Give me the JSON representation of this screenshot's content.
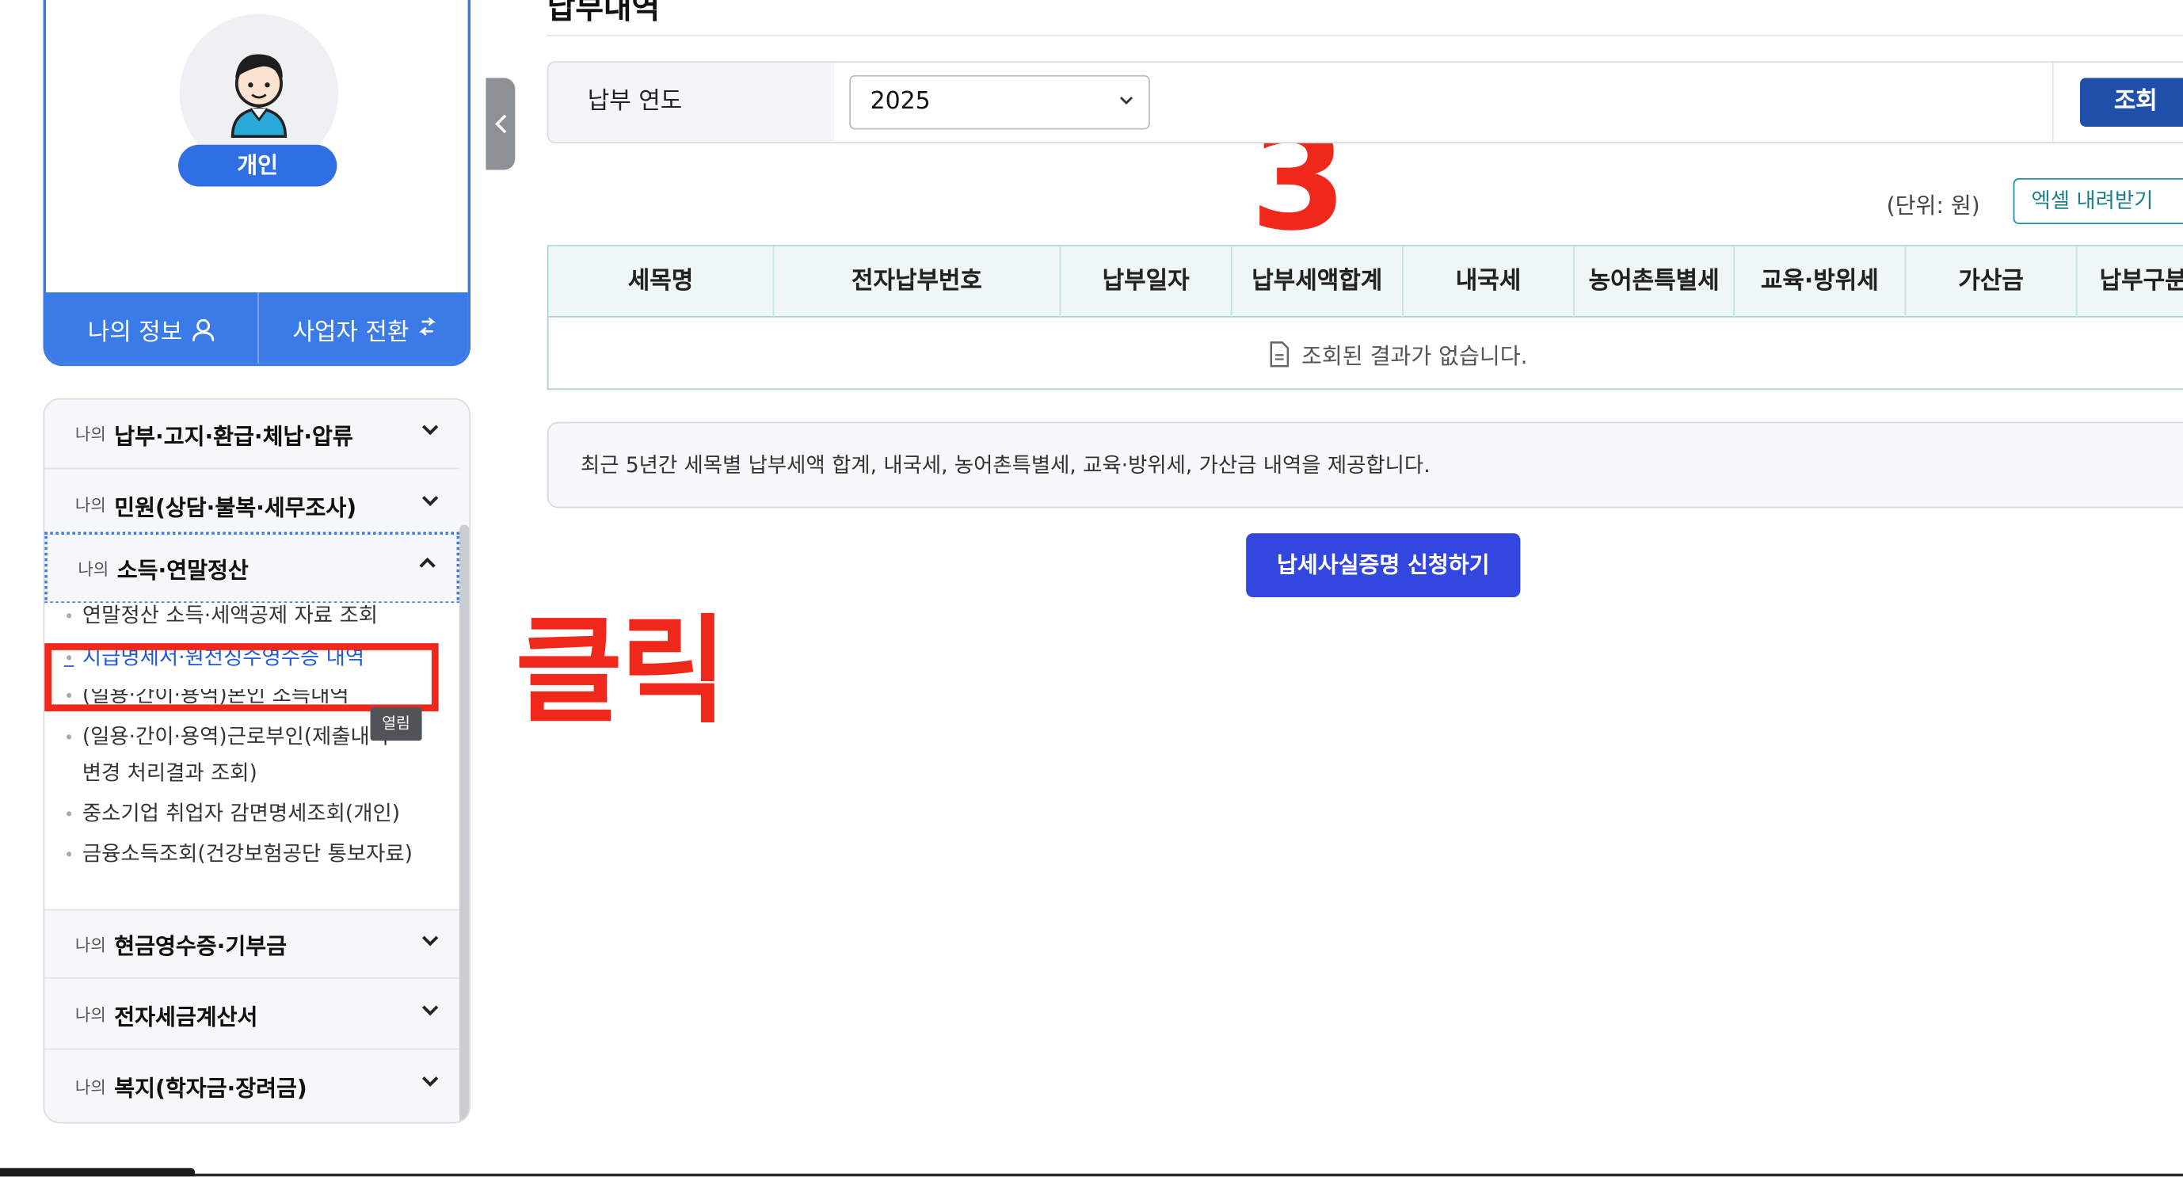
{
  "profile": {
    "badge": "개인",
    "actions": [
      {
        "label": "나의 정보",
        "icon": "person-icon"
      },
      {
        "label": "사업자 전환",
        "icon": "switch-arrows-icon"
      }
    ]
  },
  "menu": {
    "prefix": "나의",
    "groups": [
      {
        "title": "납부·고지·환급·체납·압류",
        "expanded": false
      },
      {
        "title": "민원(상담·불복·세무조사)",
        "expanded": false
      },
      {
        "title": "소득·연말정산",
        "expanded": true
      },
      {
        "title": "현금영수증·기부금",
        "expanded": false
      },
      {
        "title": "전자세금계산서",
        "expanded": false
      },
      {
        "title": "복지(학자금·장려금)",
        "expanded": false
      }
    ],
    "sub_items": [
      "연말정산 소득·세액공제 자료 조회",
      "지급명세서·원천징수영수증 내역",
      "(일용·간이·용역)본인 소득내역",
      "(일용·간이·용역)근로부인(제출내역",
      "변경 처리결과 조회)",
      "중소기업 취업자 감면명세조회(개인)",
      "금융소득조회(건강보험공단 통보자료)"
    ],
    "tooltip": "열림"
  },
  "annotations": {
    "click": "클릭",
    "step": "3",
    "color": "#f0281c"
  },
  "main": {
    "title": "납부내역",
    "filter": {
      "label": "납부 연도",
      "year": "2025",
      "search_button": "조회"
    },
    "unit": "(단위: 원)",
    "excel_button": "엑셀 내려받기",
    "table": {
      "columns": [
        "세목명",
        "전자납부번호",
        "납부일자",
        "납부세액합계",
        "내국세",
        "농어촌특별세",
        "교육·방위세",
        "가산금",
        "납부구분"
      ],
      "empty_message": "조회된 결과가 없습니다."
    },
    "info": "최근 5년간 세목별 납부세액 합계, 내국세, 농어촌특별세, 교육·방위세, 가산금 내역을 제공합니다.",
    "certificate_button": "납세사실증명 신청하기"
  },
  "colors": {
    "accent": "#3a7be8",
    "search_button": "#1f4fa8",
    "certificate_button": "#3346de",
    "table_border": "#a9d3d6",
    "table_head_bg": "#eef7f6",
    "link": "#1f5ad8"
  }
}
